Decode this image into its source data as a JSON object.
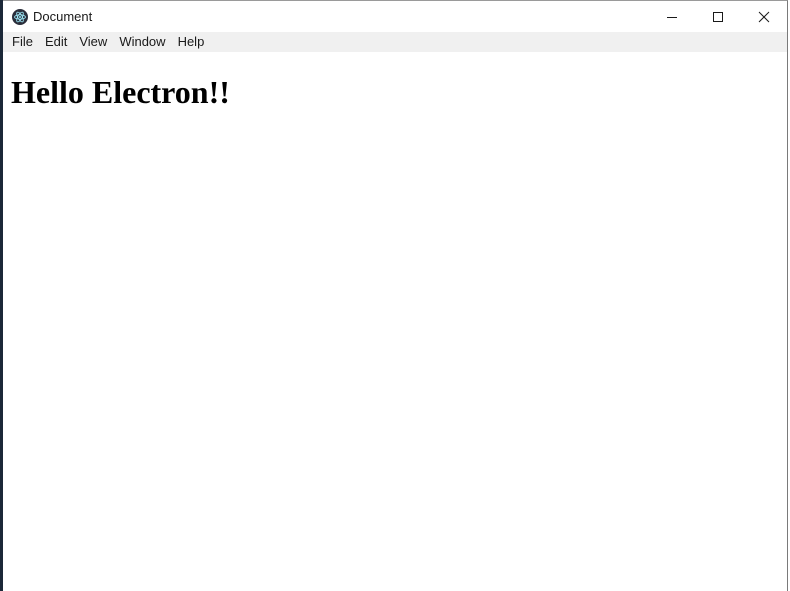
{
  "window": {
    "title": "Document",
    "icon": "electron-atom-icon",
    "caption_buttons": {
      "minimize_icon": "minimize-icon",
      "maximize_icon": "maximize-icon",
      "close_icon": "close-icon"
    }
  },
  "menubar": {
    "items": [
      {
        "label": "File"
      },
      {
        "label": "Edit"
      },
      {
        "label": "View"
      },
      {
        "label": "Window"
      },
      {
        "label": "Help"
      }
    ]
  },
  "content": {
    "heading": "Hello Electron!!"
  },
  "colors": {
    "menubar_bg": "#f0f0f0",
    "text": "#000000"
  }
}
